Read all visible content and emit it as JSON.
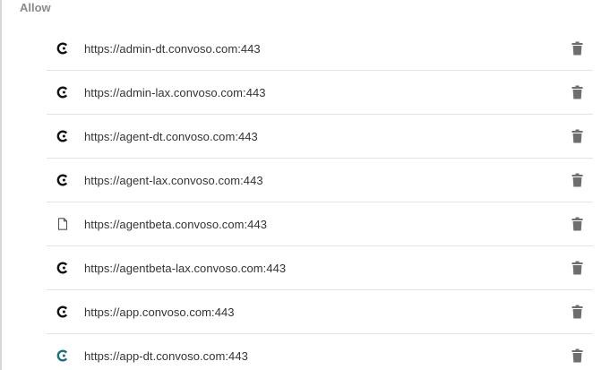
{
  "section": {
    "title": "Allow"
  },
  "sites": [
    {
      "url": "https://admin-dt.convoso.com:443",
      "icon": "convoso-logo-icon",
      "icon_color": "#111111"
    },
    {
      "url": "https://admin-lax.convoso.com:443",
      "icon": "convoso-logo-icon",
      "icon_color": "#111111"
    },
    {
      "url": "https://agent-dt.convoso.com:443",
      "icon": "convoso-logo-icon",
      "icon_color": "#111111"
    },
    {
      "url": "https://agent-lax.convoso.com:443",
      "icon": "convoso-logo-icon",
      "icon_color": "#111111"
    },
    {
      "url": "https://agentbeta.convoso.com:443",
      "icon": "page-icon",
      "icon_color": "#555555"
    },
    {
      "url": "https://agentbeta-lax.convoso.com:443",
      "icon": "convoso-logo-icon",
      "icon_color": "#111111"
    },
    {
      "url": "https://app.convoso.com:443",
      "icon": "convoso-logo-icon",
      "icon_color": "#111111"
    },
    {
      "url": "https://app-dt.convoso.com:443",
      "icon": "convoso-logo-icon",
      "icon_color": "#1f6f7a"
    }
  ],
  "delete_icon": "trash-icon",
  "colors": {
    "text": "#333333",
    "header": "#8a8a8a",
    "divider": "#e4e4e4",
    "delete_icon": "#6e6e6e"
  }
}
